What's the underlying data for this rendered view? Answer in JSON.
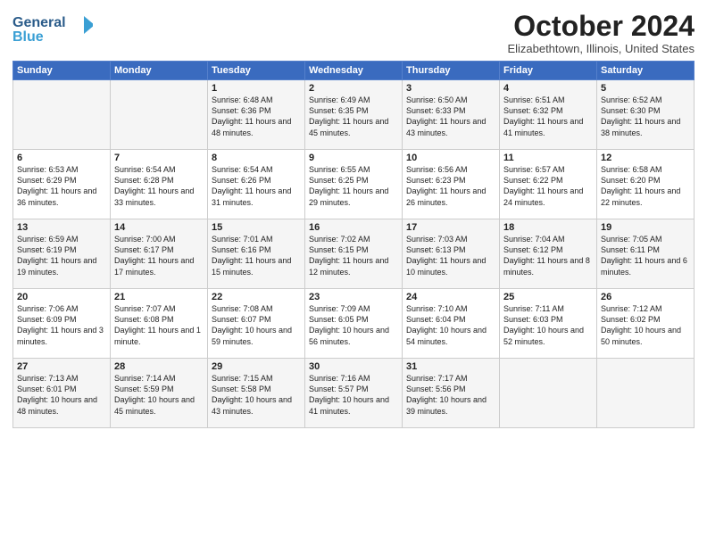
{
  "header": {
    "logo": {
      "line1": "General",
      "line2": "Blue"
    },
    "title": "October 2024",
    "location": "Elizabethtown, Illinois, United States"
  },
  "weekdays": [
    "Sunday",
    "Monday",
    "Tuesday",
    "Wednesday",
    "Thursday",
    "Friday",
    "Saturday"
  ],
  "weeks": [
    [
      {
        "day": "",
        "text": ""
      },
      {
        "day": "",
        "text": ""
      },
      {
        "day": "1",
        "text": "Sunrise: 6:48 AM\nSunset: 6:36 PM\nDaylight: 11 hours and 48 minutes."
      },
      {
        "day": "2",
        "text": "Sunrise: 6:49 AM\nSunset: 6:35 PM\nDaylight: 11 hours and 45 minutes."
      },
      {
        "day": "3",
        "text": "Sunrise: 6:50 AM\nSunset: 6:33 PM\nDaylight: 11 hours and 43 minutes."
      },
      {
        "day": "4",
        "text": "Sunrise: 6:51 AM\nSunset: 6:32 PM\nDaylight: 11 hours and 41 minutes."
      },
      {
        "day": "5",
        "text": "Sunrise: 6:52 AM\nSunset: 6:30 PM\nDaylight: 11 hours and 38 minutes."
      }
    ],
    [
      {
        "day": "6",
        "text": "Sunrise: 6:53 AM\nSunset: 6:29 PM\nDaylight: 11 hours and 36 minutes."
      },
      {
        "day": "7",
        "text": "Sunrise: 6:54 AM\nSunset: 6:28 PM\nDaylight: 11 hours and 33 minutes."
      },
      {
        "day": "8",
        "text": "Sunrise: 6:54 AM\nSunset: 6:26 PM\nDaylight: 11 hours and 31 minutes."
      },
      {
        "day": "9",
        "text": "Sunrise: 6:55 AM\nSunset: 6:25 PM\nDaylight: 11 hours and 29 minutes."
      },
      {
        "day": "10",
        "text": "Sunrise: 6:56 AM\nSunset: 6:23 PM\nDaylight: 11 hours and 26 minutes."
      },
      {
        "day": "11",
        "text": "Sunrise: 6:57 AM\nSunset: 6:22 PM\nDaylight: 11 hours and 24 minutes."
      },
      {
        "day": "12",
        "text": "Sunrise: 6:58 AM\nSunset: 6:20 PM\nDaylight: 11 hours and 22 minutes."
      }
    ],
    [
      {
        "day": "13",
        "text": "Sunrise: 6:59 AM\nSunset: 6:19 PM\nDaylight: 11 hours and 19 minutes."
      },
      {
        "day": "14",
        "text": "Sunrise: 7:00 AM\nSunset: 6:17 PM\nDaylight: 11 hours and 17 minutes."
      },
      {
        "day": "15",
        "text": "Sunrise: 7:01 AM\nSunset: 6:16 PM\nDaylight: 11 hours and 15 minutes."
      },
      {
        "day": "16",
        "text": "Sunrise: 7:02 AM\nSunset: 6:15 PM\nDaylight: 11 hours and 12 minutes."
      },
      {
        "day": "17",
        "text": "Sunrise: 7:03 AM\nSunset: 6:13 PM\nDaylight: 11 hours and 10 minutes."
      },
      {
        "day": "18",
        "text": "Sunrise: 7:04 AM\nSunset: 6:12 PM\nDaylight: 11 hours and 8 minutes."
      },
      {
        "day": "19",
        "text": "Sunrise: 7:05 AM\nSunset: 6:11 PM\nDaylight: 11 hours and 6 minutes."
      }
    ],
    [
      {
        "day": "20",
        "text": "Sunrise: 7:06 AM\nSunset: 6:09 PM\nDaylight: 11 hours and 3 minutes."
      },
      {
        "day": "21",
        "text": "Sunrise: 7:07 AM\nSunset: 6:08 PM\nDaylight: 11 hours and 1 minute."
      },
      {
        "day": "22",
        "text": "Sunrise: 7:08 AM\nSunset: 6:07 PM\nDaylight: 10 hours and 59 minutes."
      },
      {
        "day": "23",
        "text": "Sunrise: 7:09 AM\nSunset: 6:05 PM\nDaylight: 10 hours and 56 minutes."
      },
      {
        "day": "24",
        "text": "Sunrise: 7:10 AM\nSunset: 6:04 PM\nDaylight: 10 hours and 54 minutes."
      },
      {
        "day": "25",
        "text": "Sunrise: 7:11 AM\nSunset: 6:03 PM\nDaylight: 10 hours and 52 minutes."
      },
      {
        "day": "26",
        "text": "Sunrise: 7:12 AM\nSunset: 6:02 PM\nDaylight: 10 hours and 50 minutes."
      }
    ],
    [
      {
        "day": "27",
        "text": "Sunrise: 7:13 AM\nSunset: 6:01 PM\nDaylight: 10 hours and 48 minutes."
      },
      {
        "day": "28",
        "text": "Sunrise: 7:14 AM\nSunset: 5:59 PM\nDaylight: 10 hours and 45 minutes."
      },
      {
        "day": "29",
        "text": "Sunrise: 7:15 AM\nSunset: 5:58 PM\nDaylight: 10 hours and 43 minutes."
      },
      {
        "day": "30",
        "text": "Sunrise: 7:16 AM\nSunset: 5:57 PM\nDaylight: 10 hours and 41 minutes."
      },
      {
        "day": "31",
        "text": "Sunrise: 7:17 AM\nSunset: 5:56 PM\nDaylight: 10 hours and 39 minutes."
      },
      {
        "day": "",
        "text": ""
      },
      {
        "day": "",
        "text": ""
      }
    ]
  ]
}
